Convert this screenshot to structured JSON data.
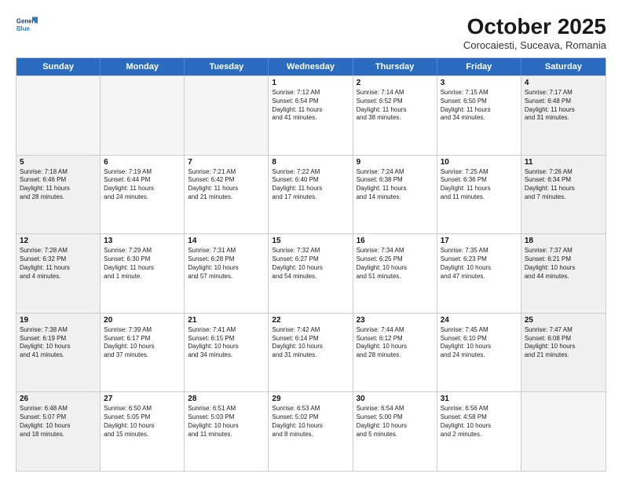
{
  "header": {
    "logo_line1": "General",
    "logo_line2": "Blue",
    "month": "October 2025",
    "location": "Corocaiesti, Suceava, Romania"
  },
  "days_of_week": [
    "Sunday",
    "Monday",
    "Tuesday",
    "Wednesday",
    "Thursday",
    "Friday",
    "Saturday"
  ],
  "weeks": [
    [
      {
        "day": "",
        "text": "",
        "empty": true
      },
      {
        "day": "",
        "text": "",
        "empty": true
      },
      {
        "day": "",
        "text": "",
        "empty": true
      },
      {
        "day": "1",
        "text": "Sunrise: 7:12 AM\nSunset: 6:54 PM\nDaylight: 11 hours\nand 41 minutes.",
        "empty": false
      },
      {
        "day": "2",
        "text": "Sunrise: 7:14 AM\nSunset: 6:52 PM\nDaylight: 11 hours\nand 38 minutes.",
        "empty": false
      },
      {
        "day": "3",
        "text": "Sunrise: 7:15 AM\nSunset: 6:50 PM\nDaylight: 11 hours\nand 34 minutes.",
        "empty": false
      },
      {
        "day": "4",
        "text": "Sunrise: 7:17 AM\nSunset: 6:48 PM\nDaylight: 11 hours\nand 31 minutes.",
        "empty": false,
        "shaded": true
      }
    ],
    [
      {
        "day": "5",
        "text": "Sunrise: 7:18 AM\nSunset: 6:46 PM\nDaylight: 11 hours\nand 28 minutes.",
        "empty": false,
        "shaded": true
      },
      {
        "day": "6",
        "text": "Sunrise: 7:19 AM\nSunset: 6:44 PM\nDaylight: 11 hours\nand 24 minutes.",
        "empty": false
      },
      {
        "day": "7",
        "text": "Sunrise: 7:21 AM\nSunset: 6:42 PM\nDaylight: 11 hours\nand 21 minutes.",
        "empty": false
      },
      {
        "day": "8",
        "text": "Sunrise: 7:22 AM\nSunset: 6:40 PM\nDaylight: 11 hours\nand 17 minutes.",
        "empty": false
      },
      {
        "day": "9",
        "text": "Sunrise: 7:24 AM\nSunset: 6:38 PM\nDaylight: 11 hours\nand 14 minutes.",
        "empty": false
      },
      {
        "day": "10",
        "text": "Sunrise: 7:25 AM\nSunset: 6:36 PM\nDaylight: 11 hours\nand 11 minutes.",
        "empty": false
      },
      {
        "day": "11",
        "text": "Sunrise: 7:26 AM\nSunset: 6:34 PM\nDaylight: 11 hours\nand 7 minutes.",
        "empty": false,
        "shaded": true
      }
    ],
    [
      {
        "day": "12",
        "text": "Sunrise: 7:28 AM\nSunset: 6:32 PM\nDaylight: 11 hours\nand 4 minutes.",
        "empty": false,
        "shaded": true
      },
      {
        "day": "13",
        "text": "Sunrise: 7:29 AM\nSunset: 6:30 PM\nDaylight: 11 hours\nand 1 minute.",
        "empty": false
      },
      {
        "day": "14",
        "text": "Sunrise: 7:31 AM\nSunset: 6:28 PM\nDaylight: 10 hours\nand 57 minutes.",
        "empty": false
      },
      {
        "day": "15",
        "text": "Sunrise: 7:32 AM\nSunset: 6:27 PM\nDaylight: 10 hours\nand 54 minutes.",
        "empty": false
      },
      {
        "day": "16",
        "text": "Sunrise: 7:34 AM\nSunset: 6:25 PM\nDaylight: 10 hours\nand 51 minutes.",
        "empty": false
      },
      {
        "day": "17",
        "text": "Sunrise: 7:35 AM\nSunset: 6:23 PM\nDaylight: 10 hours\nand 47 minutes.",
        "empty": false
      },
      {
        "day": "18",
        "text": "Sunrise: 7:37 AM\nSunset: 6:21 PM\nDaylight: 10 hours\nand 44 minutes.",
        "empty": false,
        "shaded": true
      }
    ],
    [
      {
        "day": "19",
        "text": "Sunrise: 7:38 AM\nSunset: 6:19 PM\nDaylight: 10 hours\nand 41 minutes.",
        "empty": false,
        "shaded": true
      },
      {
        "day": "20",
        "text": "Sunrise: 7:39 AM\nSunset: 6:17 PM\nDaylight: 10 hours\nand 37 minutes.",
        "empty": false
      },
      {
        "day": "21",
        "text": "Sunrise: 7:41 AM\nSunset: 6:15 PM\nDaylight: 10 hours\nand 34 minutes.",
        "empty": false
      },
      {
        "day": "22",
        "text": "Sunrise: 7:42 AM\nSunset: 6:14 PM\nDaylight: 10 hours\nand 31 minutes.",
        "empty": false
      },
      {
        "day": "23",
        "text": "Sunrise: 7:44 AM\nSunset: 6:12 PM\nDaylight: 10 hours\nand 28 minutes.",
        "empty": false
      },
      {
        "day": "24",
        "text": "Sunrise: 7:45 AM\nSunset: 6:10 PM\nDaylight: 10 hours\nand 24 minutes.",
        "empty": false
      },
      {
        "day": "25",
        "text": "Sunrise: 7:47 AM\nSunset: 6:08 PM\nDaylight: 10 hours\nand 21 minutes.",
        "empty": false,
        "shaded": true
      }
    ],
    [
      {
        "day": "26",
        "text": "Sunrise: 6:48 AM\nSunset: 5:07 PM\nDaylight: 10 hours\nand 18 minutes.",
        "empty": false,
        "shaded": true
      },
      {
        "day": "27",
        "text": "Sunrise: 6:50 AM\nSunset: 5:05 PM\nDaylight: 10 hours\nand 15 minutes.",
        "empty": false
      },
      {
        "day": "28",
        "text": "Sunrise: 6:51 AM\nSunset: 5:03 PM\nDaylight: 10 hours\nand 11 minutes.",
        "empty": false
      },
      {
        "day": "29",
        "text": "Sunrise: 6:53 AM\nSunset: 5:02 PM\nDaylight: 10 hours\nand 8 minutes.",
        "empty": false
      },
      {
        "day": "30",
        "text": "Sunrise: 6:54 AM\nSunset: 5:00 PM\nDaylight: 10 hours\nand 5 minutes.",
        "empty": false
      },
      {
        "day": "31",
        "text": "Sunrise: 6:56 AM\nSunset: 4:58 PM\nDaylight: 10 hours\nand 2 minutes.",
        "empty": false
      },
      {
        "day": "",
        "text": "",
        "empty": true,
        "shaded": true
      }
    ]
  ]
}
